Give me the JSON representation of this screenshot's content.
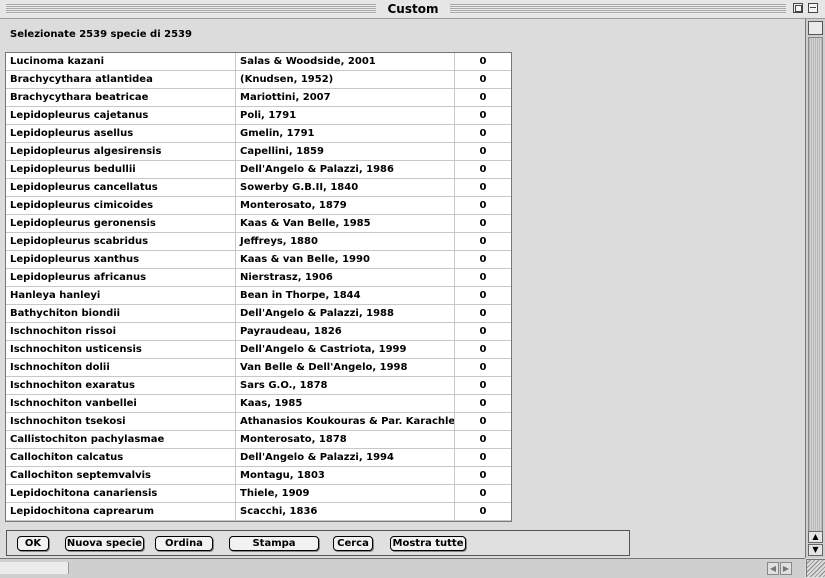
{
  "window": {
    "title": "Custom"
  },
  "header": {
    "text": "Selezionate 2539 specie di 2539"
  },
  "rows": [
    {
      "species": "Lucinoma kazani",
      "author": "Salas & Woodside, 2001",
      "count": "0"
    },
    {
      "species": "Brachycythara atlantidea",
      "author": "(Knudsen, 1952)",
      "count": "0"
    },
    {
      "species": "Brachycythara beatricae",
      "author": "Mariottini, 2007",
      "count": "0"
    },
    {
      "species": "Lepidopleurus cajetanus",
      "author": "Poli, 1791",
      "count": "0"
    },
    {
      "species": "Lepidopleurus asellus",
      "author": "Gmelin, 1791",
      "count": "0"
    },
    {
      "species": "Lepidopleurus algesirensis",
      "author": "Capellini, 1859",
      "count": "0"
    },
    {
      "species": "Lepidopleurus bedullii",
      "author": "Dell'Angelo & Palazzi, 1986",
      "count": "0"
    },
    {
      "species": "Lepidopleurus cancellatus",
      "author": "Sowerby G.B.II, 1840",
      "count": "0"
    },
    {
      "species": "Lepidopleurus cimicoides",
      "author": "Monterosato, 1879",
      "count": "0"
    },
    {
      "species": "Lepidopleurus geronensis",
      "author": "Kaas & Van Belle, 1985",
      "count": "0"
    },
    {
      "species": "Lepidopleurus scabridus",
      "author": "Jeffreys, 1880",
      "count": "0"
    },
    {
      "species": "Lepidopleurus xanthus",
      "author": "Kaas & van Belle, 1990",
      "count": "0"
    },
    {
      "species": "Lepidopleurus africanus",
      "author": "Nierstrasz, 1906",
      "count": "0"
    },
    {
      "species": "Hanleya hanleyi",
      "author": "Bean in Thorpe, 1844",
      "count": "0"
    },
    {
      "species": "Bathychiton biondii",
      "author": "Dell'Angelo & Palazzi, 1988",
      "count": "0"
    },
    {
      "species": "Ischnochiton rissoi",
      "author": "Payraudeau, 1826",
      "count": "0"
    },
    {
      "species": "Ischnochiton usticensis",
      "author": "Dell'Angelo & Castriota, 1999",
      "count": "0"
    },
    {
      "species": "Ischnochiton dolii",
      "author": "Van Belle & Dell'Angelo, 1998",
      "count": "0"
    },
    {
      "species": "Ischnochiton exaratus",
      "author": "Sars G.O., 1878",
      "count": "0"
    },
    {
      "species": "Ischnochiton vanbellei",
      "author": "Kaas, 1985",
      "count": "0"
    },
    {
      "species": "Ischnochiton tsekosi",
      "author": "Athanasios Koukouras & Par. Karachle",
      "count": "0"
    },
    {
      "species": "Callistochiton pachylasmae",
      "author": "Monterosato, 1878",
      "count": "0"
    },
    {
      "species": "Callochiton calcatus",
      "author": "Dell'Angelo & Palazzi, 1994",
      "count": "0"
    },
    {
      "species": "Callochiton septemvalvis",
      "author": "Montagu, 1803",
      "count": "0"
    },
    {
      "species": "Lepidochitona canariensis",
      "author": "Thiele, 1909",
      "count": "0"
    },
    {
      "species": "Lepidochitona caprearum",
      "author": "Scacchi, 1836",
      "count": "0"
    }
  ],
  "buttons": {
    "ok": "OK",
    "nuova_specie": "Nuova specie",
    "ordina": "Ordina",
    "stampa": "Stampa",
    "cerca": "Cerca",
    "mostra_tutte": "Mostra tutte"
  },
  "icons": {
    "zoom": "zoom-box-icon",
    "collapse": "collapse-box-icon",
    "scroll_up": "arrow-up-icon",
    "scroll_down": "arrow-down-icon",
    "scroll_left": "arrow-left-icon",
    "scroll_right": "arrow-right-icon"
  }
}
